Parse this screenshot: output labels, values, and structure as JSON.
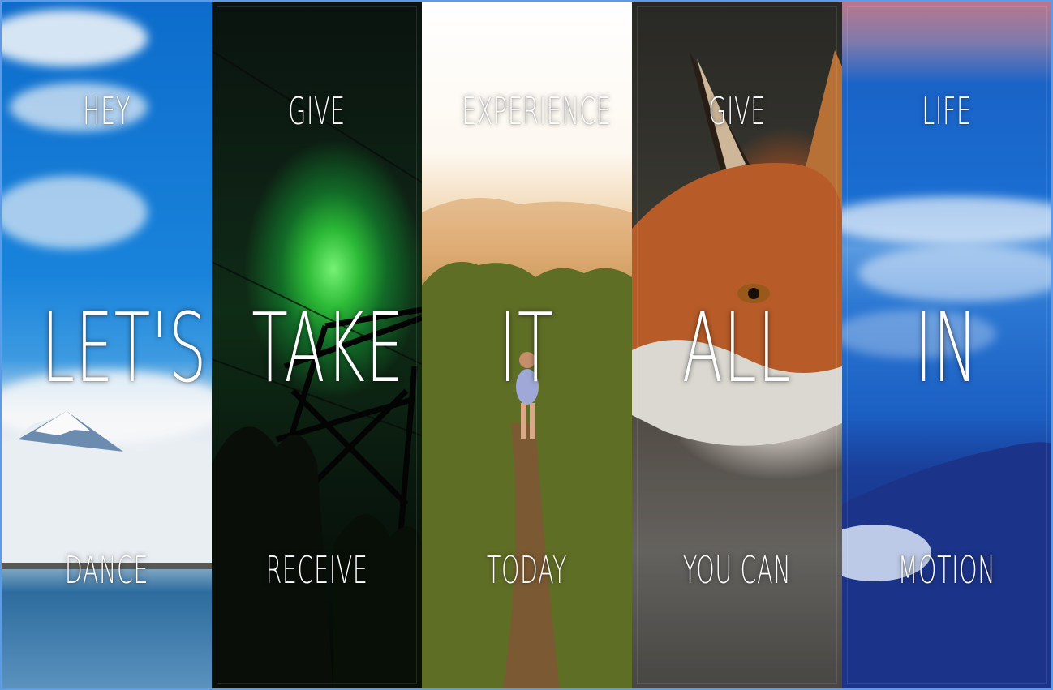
{
  "panels": [
    {
      "top": "HEY",
      "middle": "LET'S",
      "bottom": "DANCE",
      "scene": "snow-mountain-lake"
    },
    {
      "top": "GIVE",
      "middle": "TAKE",
      "bottom": "RECEIVE",
      "scene": "aurora-power-tower"
    },
    {
      "top": "EXPERIENCE",
      "middle": "IT",
      "bottom": "TODAY",
      "scene": "hiker-ridge-trail"
    },
    {
      "top": "GIVE",
      "middle": "ALL",
      "bottom": "YOU CAN",
      "scene": "red-fox"
    },
    {
      "top": "LIFE",
      "middle": "IN",
      "bottom": "MOTION",
      "scene": "clouds-mountain"
    }
  ]
}
